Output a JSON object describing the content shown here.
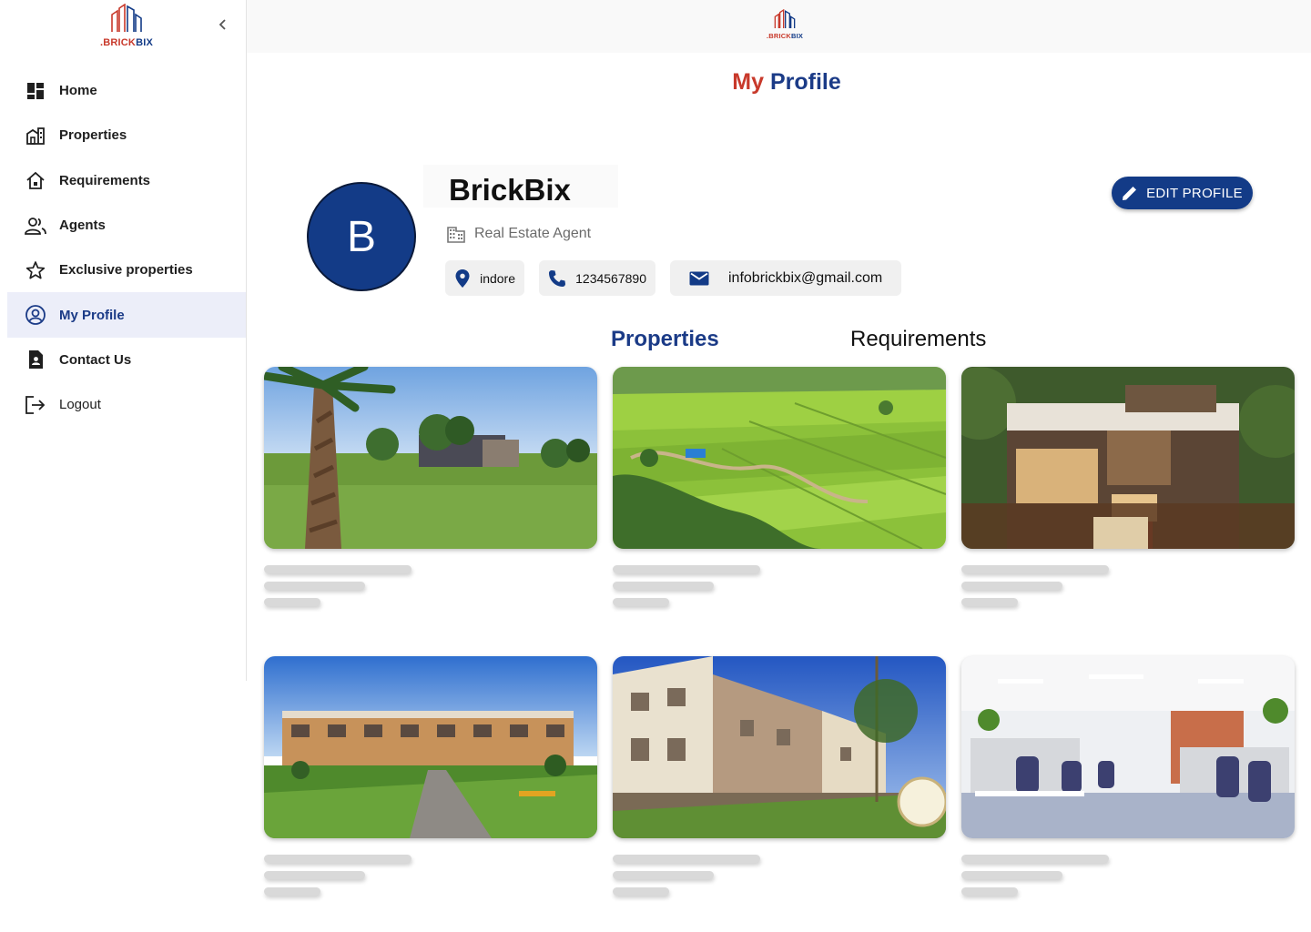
{
  "brand": {
    "prefix": ".",
    "brick": "BRICK",
    "bix": "BIX"
  },
  "sidebar": {
    "items": [
      {
        "label": "Home",
        "icon": "dashboard-icon"
      },
      {
        "label": "Properties",
        "icon": "buildings-icon"
      },
      {
        "label": "Requirements",
        "icon": "house-search-icon"
      },
      {
        "label": "Agents",
        "icon": "people-icon"
      },
      {
        "label": "Exclusive properties",
        "icon": "star-icon"
      },
      {
        "label": "My Profile",
        "icon": "account-circle-icon",
        "active": true
      },
      {
        "label": "Contact Us",
        "icon": "contact-doc-icon"
      },
      {
        "label": "Logout",
        "icon": "logout-icon"
      }
    ]
  },
  "page": {
    "title_part1": "My",
    "title_part2": "Profile"
  },
  "profile": {
    "avatar_letter": "B",
    "name": "BrickBix",
    "role": "Real Estate Agent",
    "location": "indore",
    "phone": "1234567890",
    "email": "infobrickbix@gmail.com",
    "edit_label": "EDIT PROFILE"
  },
  "tabs": {
    "properties": "Properties",
    "requirements": "Requirements"
  },
  "colors": {
    "brand_blue": "#133b87",
    "brand_red": "#c8392b",
    "active_bg": "#eceef9"
  },
  "properties": [
    {
      "image": "palm-tree-lawn-photo"
    },
    {
      "image": "aerial-green-fields-photo"
    },
    {
      "image": "modern-villa-photo"
    },
    {
      "image": "row-houses-garden-photo"
    },
    {
      "image": "townhouses-street-photo"
    },
    {
      "image": "office-workspace-photo"
    }
  ]
}
